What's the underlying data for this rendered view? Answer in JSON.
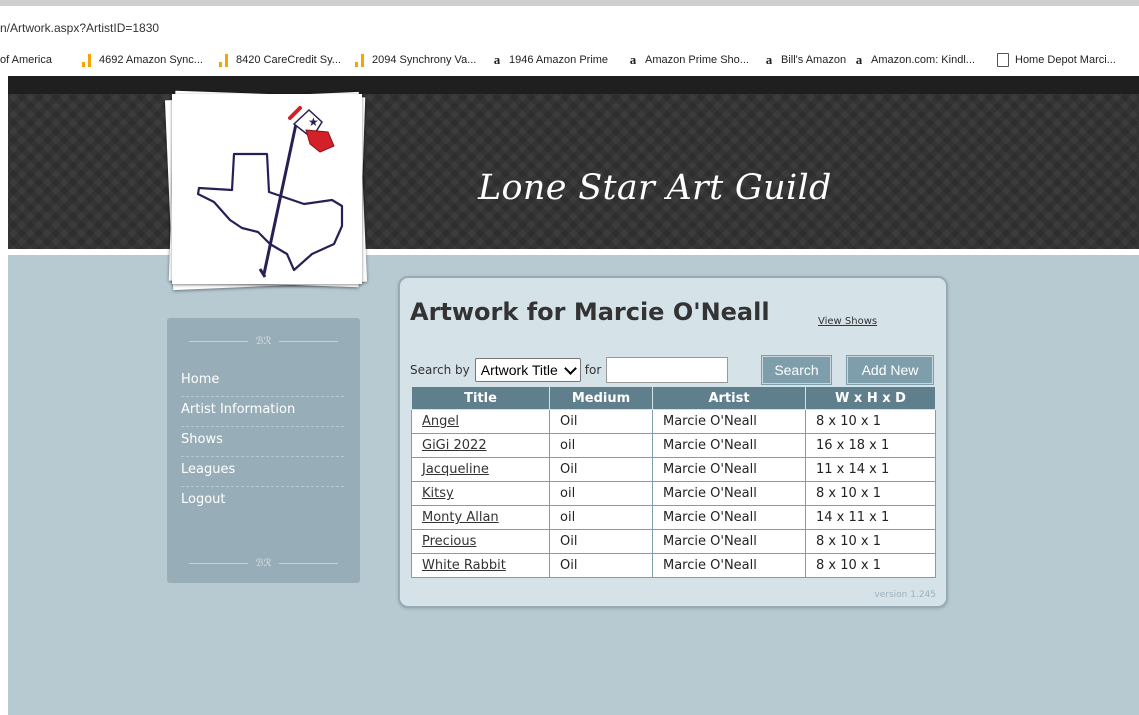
{
  "browser": {
    "url": "n/Artwork.aspx?ArtistID=1830",
    "bookmarks": [
      {
        "label": "of America",
        "icon": "none"
      },
      {
        "label": "4692 Amazon Sync...",
        "icon": "bar-chart-icon"
      },
      {
        "label": "8420 CareCredit Sy...",
        "icon": "bar-chart-icon"
      },
      {
        "label": "2094 Synchrony Va...",
        "icon": "bar-chart-icon"
      },
      {
        "label": "1946 Amazon Prime",
        "icon": "amazon-icon"
      },
      {
        "label": "Amazon Prime Sho...",
        "icon": "amazon-icon"
      },
      {
        "label": "Bill's Amazon",
        "icon": "amazon-icon"
      },
      {
        "label": "Amazon.com: Kindl...",
        "icon": "amazon-icon"
      },
      {
        "label": "Home Depot Marci...",
        "icon": "document-icon"
      }
    ]
  },
  "site": {
    "title": "Lone Star Art Guild"
  },
  "sidebar": {
    "ornament": "ℬℛ",
    "items": [
      {
        "label": "Home"
      },
      {
        "label": "Artist Information"
      },
      {
        "label": "Shows"
      },
      {
        "label": "Leagues"
      },
      {
        "label": "Logout"
      }
    ]
  },
  "main": {
    "heading": "Artwork for Marcie O'Neall",
    "view_shows": "View Shows",
    "search_by_label": "Search by",
    "search_field_selected": "Artwork Title",
    "for_label": "for",
    "search_input_value": "",
    "search_button": "Search",
    "add_new_button": "Add New",
    "columns": [
      "Title",
      "Medium",
      "Artist",
      "W x H x D"
    ],
    "rows": [
      [
        "Angel",
        "Oil",
        "Marcie O'Neall",
        "8 x 10 x 1"
      ],
      [
        "GiGi 2022",
        "oil",
        "Marcie O'Neall",
        "16 x 18 x 1"
      ],
      [
        "Jacqueline",
        "Oil",
        "Marcie O'Neall",
        "11 x 14 x 1"
      ],
      [
        "Kitsy",
        "oil",
        "Marcie O'Neall",
        "8 x 10 x 1"
      ],
      [
        "Monty Allan",
        "oil",
        "Marcie O'Neall",
        "14 x 11 x 1"
      ],
      [
        "Precious",
        "Oil",
        "Marcie O'Neall",
        "8 x 10 x 1"
      ],
      [
        "White Rabbit",
        "Oil",
        "Marcie O'Neall",
        "8 x 10 x 1"
      ]
    ],
    "version": "version 1.245"
  },
  "colors": {
    "header_bg": "#323232",
    "page_bg": "#b7cad2",
    "sidebar_bg": "#97adb8",
    "table_header": "#607f8d",
    "button_bg": "#7f9eab"
  }
}
